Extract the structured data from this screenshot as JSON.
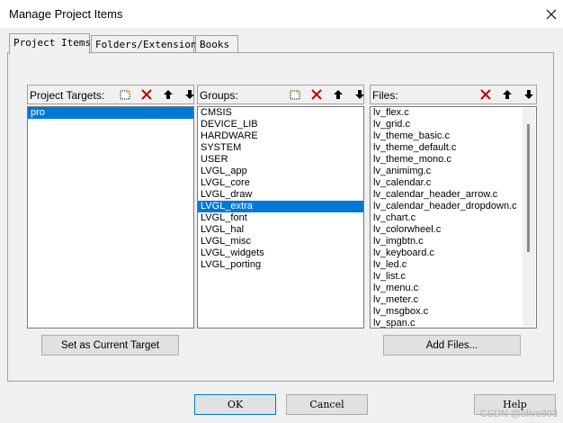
{
  "window": {
    "title": "Manage Project Items"
  },
  "tabs": [
    {
      "label": "Project Items"
    },
    {
      "label": "Folders/Extensions"
    },
    {
      "label": "Books"
    }
  ],
  "targets": {
    "label": "Project Targets:",
    "items": [
      "pro"
    ],
    "selected": "pro",
    "button": "Set as Current Target"
  },
  "groups": {
    "label": "Groups:",
    "items": [
      "CMSIS",
      "DEVICE_LIB",
      "HARDWARE",
      "SYSTEM",
      "USER",
      "LVGL_app",
      "LVGL_core",
      "LVGL_draw",
      "LVGL_extra",
      "LVGL_font",
      "LVGL_hal",
      "LVGL_misc",
      "LVGL_widgets",
      "LVGL_porting"
    ],
    "selected": "LVGL_extra"
  },
  "files": {
    "label": "Files:",
    "items": [
      "lv_flex.c",
      "lv_grid.c",
      "lv_theme_basic.c",
      "lv_theme_default.c",
      "lv_theme_mono.c",
      "lv_animimg.c",
      "lv_calendar.c",
      "lv_calendar_header_arrow.c",
      "lv_calendar_header_dropdown.c",
      "lv_chart.c",
      "lv_colorwheel.c",
      "lv_imgbtn.c",
      "lv_keyboard.c",
      "lv_led.c",
      "lv_list.c",
      "lv_menu.c",
      "lv_meter.c",
      "lv_msgbox.c",
      "lv_span.c"
    ],
    "button": "Add Files..."
  },
  "footer": {
    "ok": "OK",
    "cancel": "Cancel",
    "help": "Help"
  },
  "watermark": "CSDN @olive903",
  "colors": {
    "selection": "#0078d7",
    "delete_red": "#c00000"
  },
  "icons": [
    "close-icon",
    "new-item-icon",
    "delete-icon",
    "move-up-icon",
    "move-down-icon"
  ]
}
